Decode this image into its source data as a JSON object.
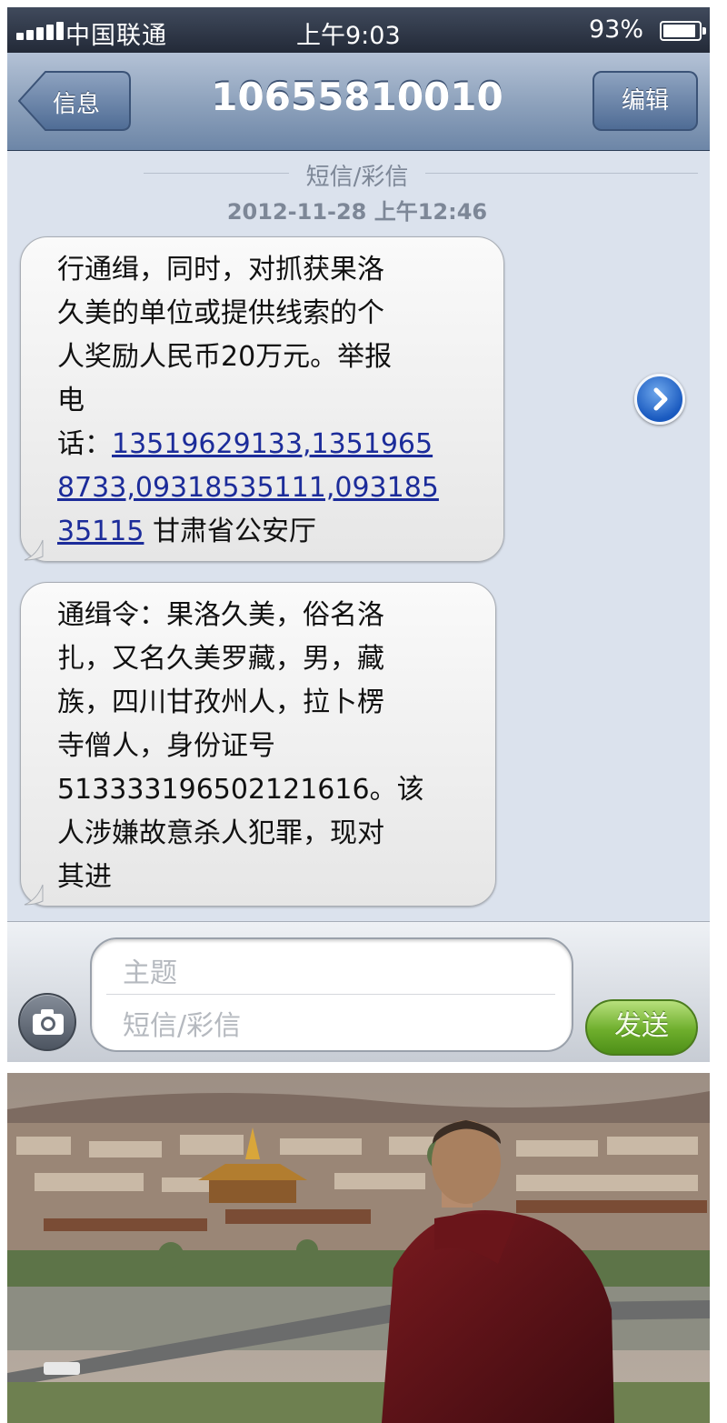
{
  "status_bar": {
    "carrier": "中国联通",
    "time": "上午9:03",
    "battery": "93%",
    "battery_level": 0.93
  },
  "nav_bar": {
    "back_label": "信息",
    "title": "10655810010",
    "edit_label": "编辑"
  },
  "thread": {
    "type_label": "短信/彩信",
    "timestamp": "2012-11-28 上午12:46",
    "messages": [
      {
        "lines": [
          "行通缉，同时，对抓获果洛",
          "久美的单位或提供线索的个",
          "人奖励人民币20万元。举报",
          "电",
          "话：",
          "13519629133,1351965",
          "8733,09318535111,093185",
          "35115",
          "甘肃省公安厅"
        ]
      },
      {
        "lines": [
          "通缉令：果洛久美，俗名洛",
          "扎，又名久美罗藏，男，藏",
          "族，四川甘孜州人，拉卜楞",
          "寺僧人，身份证号",
          "513333196502121616。该",
          "人涉嫌故意杀人犯罪，现对",
          "其进"
        ]
      }
    ]
  },
  "compose": {
    "subject_placeholder": "主题",
    "body_placeholder": "短信/彩信",
    "send_label": "发送"
  },
  "icons": {
    "camera": "camera-icon",
    "detail": "chevron-right-icon",
    "back": "back-arrow-button"
  },
  "colors": {
    "nav_bar": "#8fa3bd",
    "link": "#1c2c9a",
    "send_button": "#6eae2c",
    "background": "#dbe2ed"
  }
}
